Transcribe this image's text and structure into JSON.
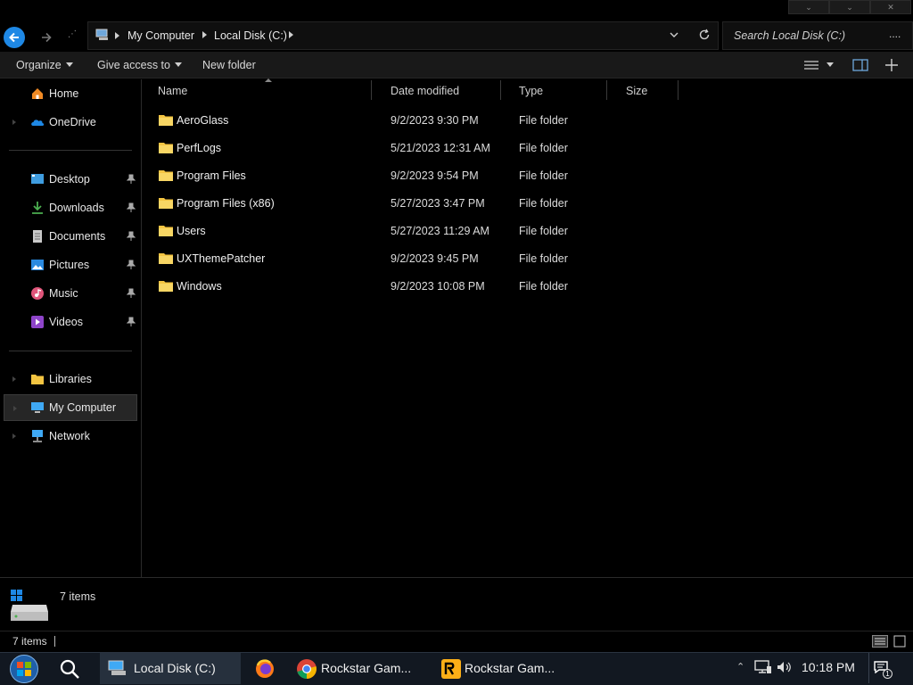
{
  "address": {
    "breadcrumbs": [
      "My Computer",
      "Local Disk (C:)"
    ],
    "search_placeholder": "Search Local Disk (C:)",
    "more": "...."
  },
  "toolbar": {
    "organize": "Organize",
    "give_access": "Give access to",
    "new_folder": "New folder"
  },
  "nav": {
    "home": "Home",
    "onedrive": "OneDrive",
    "quick_access": [
      {
        "label": "Desktop",
        "icon": "desktop-icon"
      },
      {
        "label": "Downloads",
        "icon": "downloads-icon"
      },
      {
        "label": "Documents",
        "icon": "documents-icon"
      },
      {
        "label": "Pictures",
        "icon": "pictures-icon"
      },
      {
        "label": "Music",
        "icon": "music-icon"
      },
      {
        "label": "Videos",
        "icon": "videos-icon"
      }
    ],
    "libraries": "Libraries",
    "my_computer": "My Computer",
    "network": "Network"
  },
  "columns": [
    "Name",
    "Date modified",
    "Type",
    "Size"
  ],
  "files": [
    {
      "name": "AeroGlass",
      "date": "9/2/2023 9:30 PM",
      "type": "File folder"
    },
    {
      "name": "PerfLogs",
      "date": "5/21/2023 12:31 AM",
      "type": "File folder"
    },
    {
      "name": "Program Files",
      "date": "9/2/2023 9:54 PM",
      "type": "File folder"
    },
    {
      "name": "Program Files (x86)",
      "date": "5/27/2023 3:47 PM",
      "type": "File folder"
    },
    {
      "name": "Users",
      "date": "5/27/2023 11:29 AM",
      "type": "File folder"
    },
    {
      "name": "UXThemePatcher",
      "date": "9/2/2023 9:45 PM",
      "type": "File folder"
    },
    {
      "name": "Windows",
      "date": "9/2/2023 10:08 PM",
      "type": "File folder"
    }
  ],
  "details": {
    "count": "7 items"
  },
  "status": {
    "count": "7 items"
  },
  "taskbar": {
    "items": [
      "Local Disk (C:)",
      "Rockstar Gam...",
      "Rockstar Gam..."
    ],
    "time": "10:18 PM",
    "notification_count": "1"
  },
  "colors": {
    "folder": "#f4c542",
    "accent": "#1e88e5",
    "taskbar": "#121821"
  }
}
